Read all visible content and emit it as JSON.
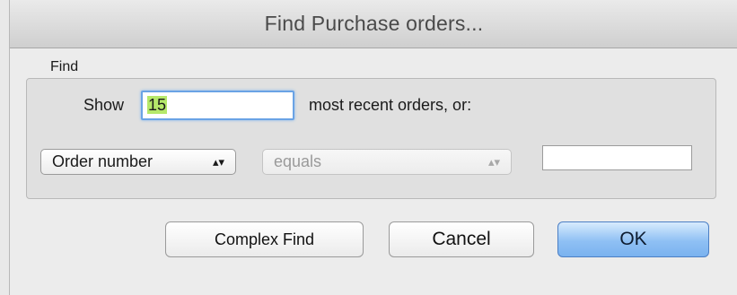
{
  "dialog": {
    "title": "Find Purchase orders..."
  },
  "find_group": {
    "label": "Find",
    "show_label": "Show",
    "count_value": "15",
    "recent_label": "most recent orders, or:",
    "field_selected": "Order number",
    "operator_selected": "equals",
    "search_value": ""
  },
  "buttons": {
    "complex_find": "Complex Find",
    "cancel": "Cancel",
    "ok": "OK"
  },
  "icons": {
    "popup_arrows": "up-down-chevron-icon"
  },
  "colors": {
    "default_button": "#8fc0f4",
    "focus_ring": "#6aa3e5",
    "text_selection": "#b5e86a"
  }
}
